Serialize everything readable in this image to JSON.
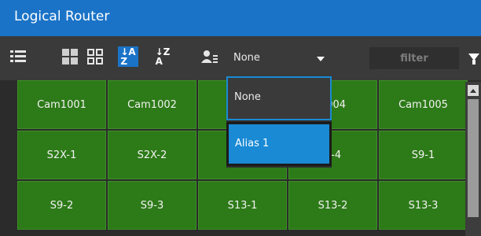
{
  "window": {
    "title": "Logical Router"
  },
  "toolbar": {
    "icons": [
      "list-view-icon",
      "tile-large-icon",
      "tile-small-icon",
      "sort-ascending-icon",
      "sort-descending-icon",
      "alias-icon"
    ],
    "sort_asc": "↓A\nZ",
    "sort_desc": "↓Z\nA",
    "alias_select": {
      "value": "None",
      "options": [
        "None",
        "Alias 1"
      ],
      "highlighted": "Alias 1"
    },
    "filter": {
      "placeholder": "filter",
      "value": ""
    }
  },
  "grid": {
    "rows": [
      [
        "Cam1001",
        "Cam1002",
        "C",
        "1004",
        "Cam1005"
      ],
      [
        "S2X-1",
        "S2X-2",
        "",
        "X-4",
        "S9-1"
      ],
      [
        "S9-2",
        "S9-3",
        "S13-1",
        "S13-2",
        "S13-3"
      ]
    ]
  },
  "colors": {
    "accent": "#1a73c7",
    "cell": "#2d7a18",
    "dropdown_highlight": "#1a8ad4"
  }
}
